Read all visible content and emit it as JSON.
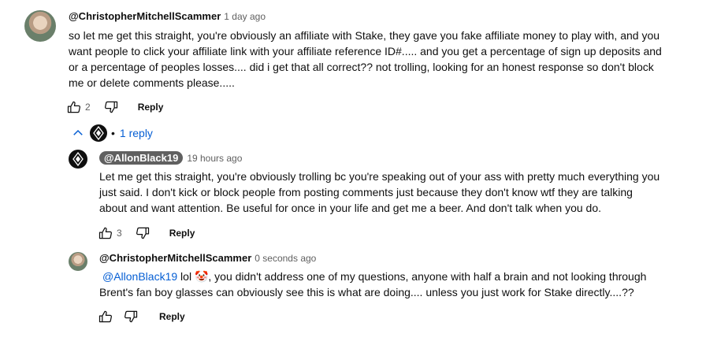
{
  "comment": {
    "author": "@ChristopherMitchellScammer",
    "time": "1 day ago",
    "text_lines": [
      "so let me get this straight, you're obviously an affiliate with Stake, they gave you fake affiliate money to play with, and you",
      "want people to click your affiliate link with your affiliate reference ID#..... and you get a percentage of sign up deposits and",
      "or a percentage of peoples losses.... did i get that all correct??  not trolling, looking for an honest response so don't block",
      "me or delete comments please....."
    ],
    "likes": "2",
    "reply_label": "Reply"
  },
  "replies_toggle": {
    "bullet": "•",
    "label": "1 reply"
  },
  "reply1": {
    "author": "@AllonBlack19",
    "time": "19 hours ago",
    "text_lines": [
      "Let me get this straight, you're obviously trolling bc you're speaking out of your ass with pretty much everything you",
      "just said. I don't kick or block people from posting comments just because they don't know wtf they are talking",
      "about and want attention. Be useful for once in your life  and get me a beer. And don't talk when you do."
    ],
    "likes": "3",
    "reply_label": "Reply"
  },
  "reply2": {
    "author": "@ChristopherMitchellScammer",
    "time": "0 seconds ago",
    "mention": "@AllonBlack19",
    "line1_rest": " lol 🤡, you didn't address one of my questions, anyone with half a brain and not looking through",
    "line2": "Brent's fan boy glasses can obviously see this is what are doing.... unless you just work for Stake directly....??",
    "reply_label": "Reply"
  },
  "colors": {
    "link_blue": "#065fd4",
    "muted_gray": "#606060",
    "text": "#0f0f0f"
  }
}
